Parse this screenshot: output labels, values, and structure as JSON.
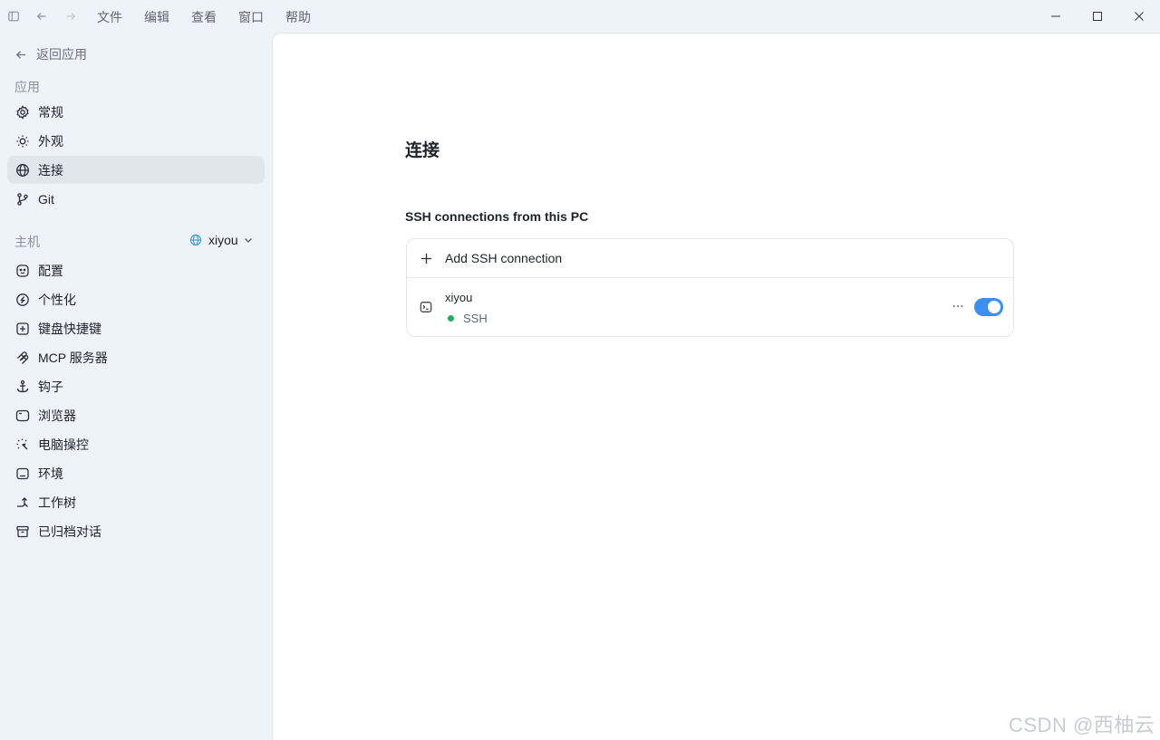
{
  "titlebar": {
    "menu": [
      "文件",
      "编辑",
      "查看",
      "窗口",
      "帮助"
    ]
  },
  "sidebar": {
    "back_label": "返回应用",
    "app_section_label": "应用",
    "app_items": [
      {
        "label": "常规",
        "icon": "gear-icon"
      },
      {
        "label": "外观",
        "icon": "sun-icon"
      },
      {
        "label": "连接",
        "icon": "globe-icon",
        "active": true
      },
      {
        "label": "Git",
        "icon": "git-branch-icon"
      }
    ],
    "host_section_label": "主机",
    "host_value": "xiyou",
    "host_items": [
      {
        "label": "配置",
        "icon": "config-icon"
      },
      {
        "label": "个性化",
        "icon": "personalize-icon"
      },
      {
        "label": "键盘快捷键",
        "icon": "keyboard-shortcut-icon"
      },
      {
        "label": "MCP 服务器",
        "icon": "mcp-server-icon"
      },
      {
        "label": "钩子",
        "icon": "hook-icon"
      },
      {
        "label": "浏览器",
        "icon": "browser-icon"
      },
      {
        "label": "电脑操控",
        "icon": "computer-control-icon"
      },
      {
        "label": "环境",
        "icon": "environment-icon"
      },
      {
        "label": "工作树",
        "icon": "worktree-icon"
      },
      {
        "label": "已归档对话",
        "icon": "archive-icon"
      }
    ]
  },
  "main": {
    "page_title": "连接",
    "section_title": "SSH connections from this PC",
    "add_connection_label": "Add SSH connection",
    "connections": [
      {
        "name": "xiyou",
        "type": "SSH",
        "status_color": "#1bb15a",
        "enabled": true
      }
    ]
  },
  "watermark": "CSDN @西柚云",
  "colors": {
    "accent": "#3a8ff0",
    "sidebar_bg": "#eef3f8",
    "active_item_bg": "#e1e6eb"
  }
}
